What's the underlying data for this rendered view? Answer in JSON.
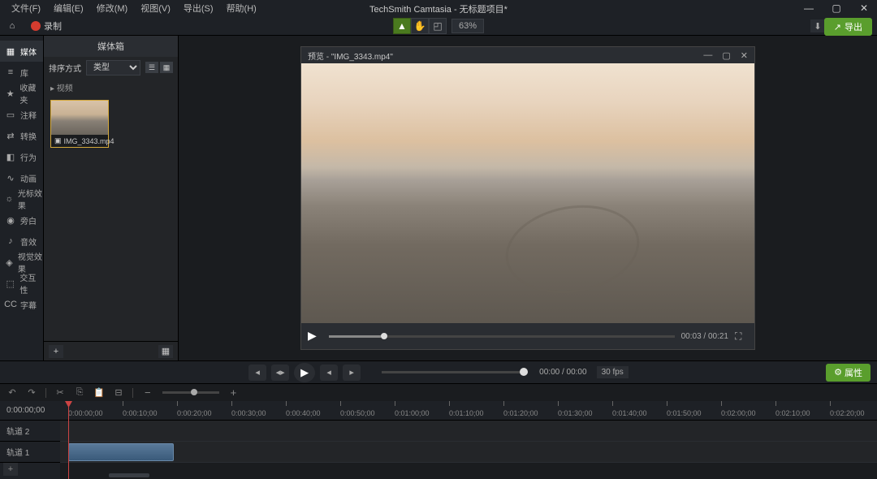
{
  "app": {
    "title": "TechSmith Camtasia - 无标题项目*"
  },
  "menu": [
    "文件(F)",
    "编辑(E)",
    "修改(M)",
    "视图(V)",
    "导出(S)",
    "帮助(H)"
  ],
  "toolbar": {
    "record_label": "录制",
    "zoom": "63%",
    "export_label": "导出"
  },
  "sidebar": [
    {
      "icon": "▦",
      "label": "媒体"
    },
    {
      "icon": "≡",
      "label": "库"
    },
    {
      "icon": "★",
      "label": "收藏夹"
    },
    {
      "icon": "▭",
      "label": "注释"
    },
    {
      "icon": "⇄",
      "label": "转换"
    },
    {
      "icon": "◧",
      "label": "行为"
    },
    {
      "icon": "∿",
      "label": "动画"
    },
    {
      "icon": "☼",
      "label": "光标效果"
    },
    {
      "icon": "◉",
      "label": "旁白"
    },
    {
      "icon": "♪",
      "label": "音效"
    },
    {
      "icon": "◈",
      "label": "视觉效果"
    },
    {
      "icon": "⬚",
      "label": "交互性"
    },
    {
      "icon": "CC",
      "label": "字幕"
    }
  ],
  "media_panel": {
    "title": "媒体箱",
    "sort_label": "排序方式",
    "sort_value": "类型",
    "category": "▸ 视频",
    "clip_name": "IMG_3343.mp4"
  },
  "preview": {
    "title": "预览 - \"IMG_3343.mp4\"",
    "time": "00:03 / 00:21"
  },
  "playback": {
    "time": "00:00 / 00:00",
    "fps": "30 fps",
    "props_label": "属性"
  },
  "timeline": {
    "tracks": [
      "轨道 2",
      "轨道 1"
    ],
    "playhead_time": "0:00:00;00",
    "ticks": [
      "0:00:00;00",
      "0:00:10;00",
      "0:00:20;00",
      "0:00:30;00",
      "0:00:40;00",
      "0:00:50;00",
      "0:01:00;00",
      "0:01:10;00",
      "0:01:20;00",
      "0:01:30;00",
      "0:01:40;00",
      "0:01:50;00",
      "0:02:00;00",
      "0:02:10;00",
      "0:02:20;00"
    ]
  }
}
